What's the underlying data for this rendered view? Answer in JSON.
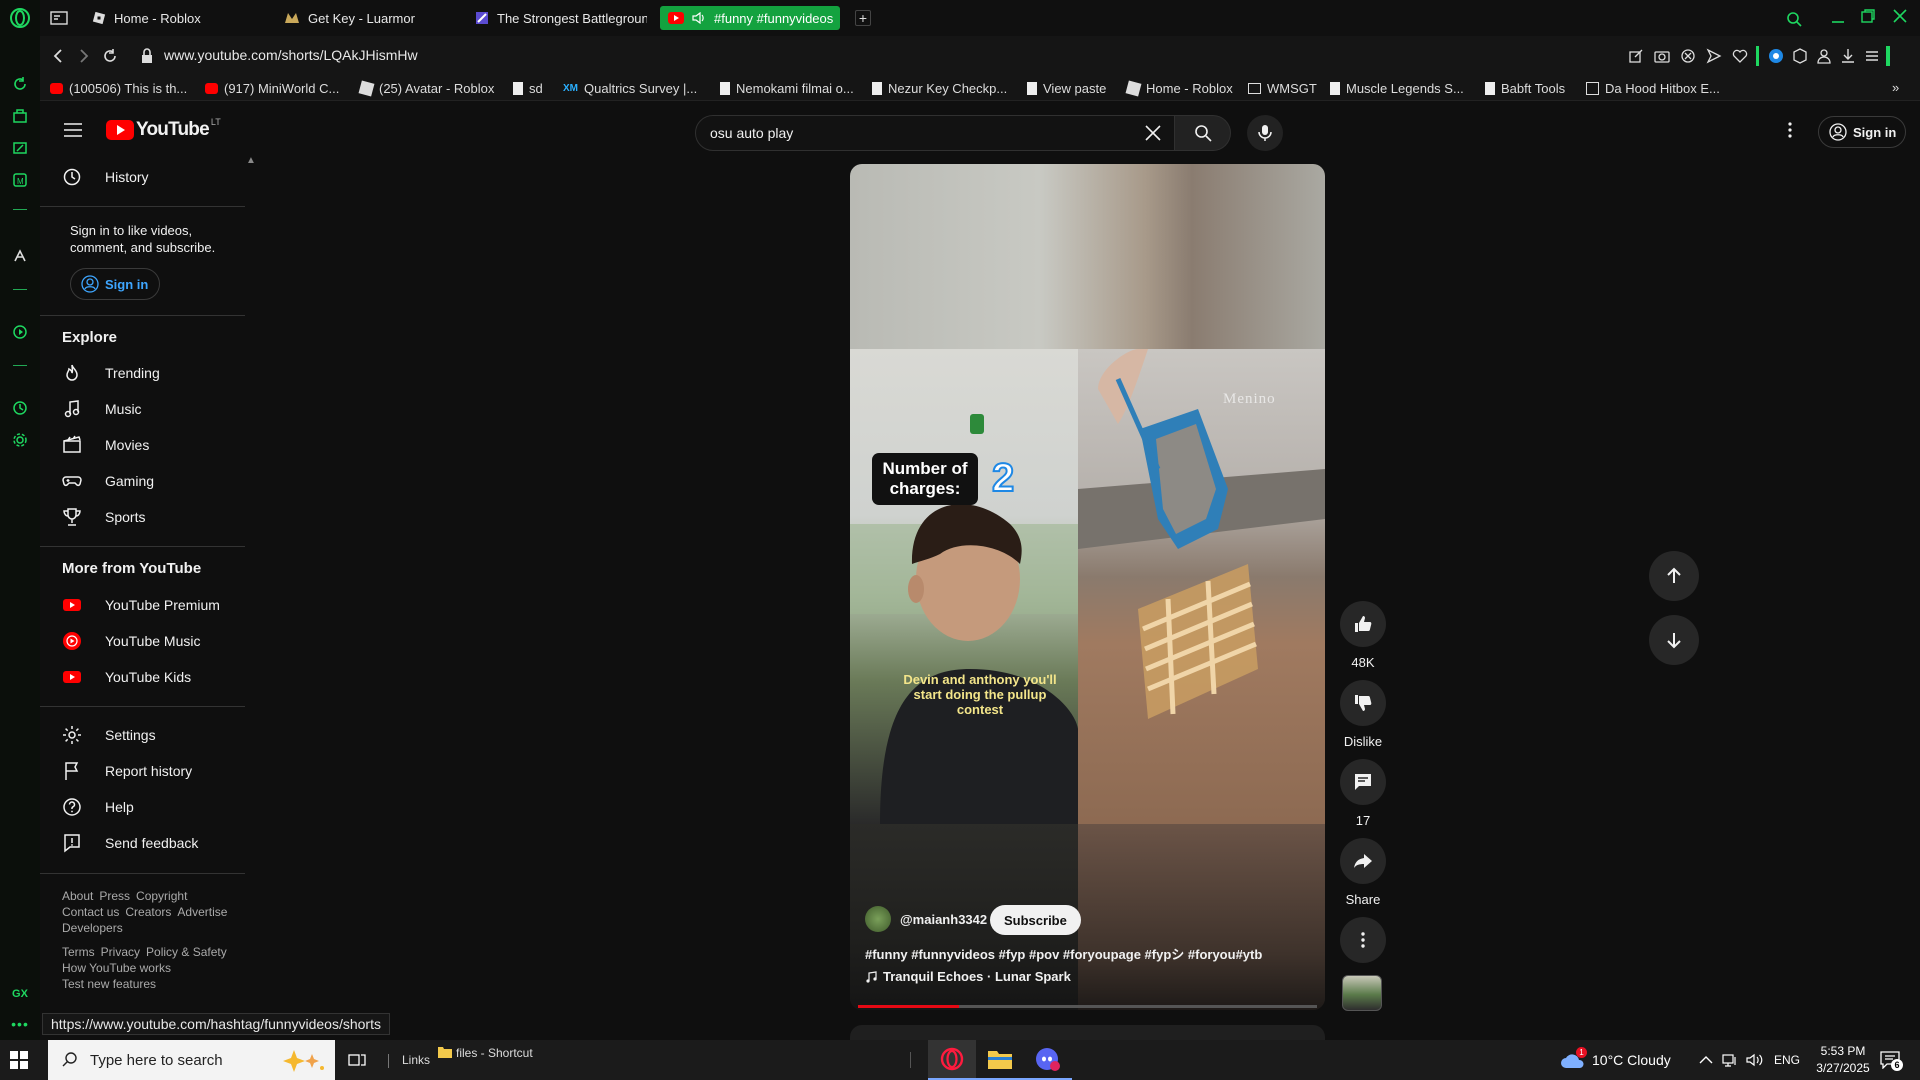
{
  "colors": {
    "opera_green": "#1ed760",
    "tab_active": "#13a23f",
    "yt_red": "#ff0000",
    "progress_red": "#e50914"
  },
  "browser": {
    "tabs": [
      {
        "label": "Home - Roblox",
        "icon": "roblox-icon",
        "active": false
      },
      {
        "label": "Get Key - Luarmor",
        "icon": "luarmor-icon",
        "active": false
      },
      {
        "label": "The Strongest Battlegroun",
        "icon": "battlegrounds-icon",
        "active": false
      },
      {
        "label": "#funny #funnyvideos",
        "icon": "youtube-icon",
        "active": true
      }
    ],
    "url": "www.youtube.com/shorts/LQAkJHismHw",
    "bookmarks": [
      {
        "label": "(100506) This is th...",
        "icon": "youtube-icon"
      },
      {
        "label": "(917) MiniWorld C...",
        "icon": "youtube-icon"
      },
      {
        "label": "(25) Avatar - Roblox",
        "icon": "roblox-icon"
      },
      {
        "label": "sd",
        "icon": "doc-icon"
      },
      {
        "label": "Qualtrics Survey |...",
        "icon": "xm-icon",
        "badge": "XM"
      },
      {
        "label": "Nemokami filmai o...",
        "icon": "doc-icon"
      },
      {
        "label": "Nezur Key Checkp...",
        "icon": "doc-icon"
      },
      {
        "label": "View paste",
        "icon": "doc-icon"
      },
      {
        "label": "Home - Roblox",
        "icon": "roblox-icon"
      },
      {
        "label": "WMSGT",
        "icon": "folder-icon"
      },
      {
        "label": "Muscle Legends S...",
        "icon": "doc-icon"
      },
      {
        "label": "Babft Tools",
        "icon": "doc-icon"
      },
      {
        "label": "Da Hood Hitbox E...",
        "icon": "grid-icon"
      }
    ],
    "status_url": "https://www.youtube.com/hashtag/funnyvideos/shorts"
  },
  "youtube": {
    "logo_text": "YouTube",
    "country_code": "LT",
    "search_value": "osu auto play",
    "sign_in_label": "Sign in",
    "sidebar": {
      "history": "History",
      "signin_prompt": "Sign in to like videos, comment, and subscribe.",
      "signin_button": "Sign in",
      "explore_heading": "Explore",
      "explore": [
        {
          "label": "Trending",
          "icon": "trending-icon"
        },
        {
          "label": "Music",
          "icon": "music-icon"
        },
        {
          "label": "Movies",
          "icon": "movies-icon"
        },
        {
          "label": "Gaming",
          "icon": "gaming-icon"
        },
        {
          "label": "Sports",
          "icon": "trophy-icon"
        }
      ],
      "more_heading": "More from YouTube",
      "more": [
        {
          "label": "YouTube Premium",
          "icon": "yt-premium-icon"
        },
        {
          "label": "YouTube Music",
          "icon": "yt-music-icon"
        },
        {
          "label": "YouTube Kids",
          "icon": "yt-kids-icon"
        }
      ],
      "settings": [
        {
          "label": "Settings",
          "icon": "gear-icon"
        },
        {
          "label": "Report history",
          "icon": "flag-icon"
        },
        {
          "label": "Help",
          "icon": "help-icon"
        },
        {
          "label": "Send feedback",
          "icon": "feedback-icon"
        }
      ],
      "footer1": [
        "About",
        "Press",
        "Copyright",
        "Contact us",
        "Creators",
        "Advertise",
        "Developers"
      ],
      "footer2": [
        "Terms",
        "Privacy",
        "Policy & Safety",
        "How YouTube works",
        "Test new features"
      ]
    },
    "short": {
      "overlay_label": "Number of charges:",
      "overlay_number": "2",
      "watermark": "Menino",
      "caption": "Devin and anthony you'll start doing the pullup contest",
      "channel": "@maianh3342",
      "subscribe": "Subscribe",
      "title": "#funny #funnyvideos #fyp #pov #foryoupage #fypシ #foryou#ytb",
      "music": "Tranquil Echoes · Lunar Spark",
      "progress": 0.22
    },
    "actions": {
      "likes": "48K",
      "dislike": "Dislike",
      "comments": "17",
      "share": "Share"
    }
  },
  "taskbar": {
    "search_placeholder": "Type here to search",
    "links": "Links",
    "shortcut": "files - Shortcut",
    "weather": "10°C  Cloudy",
    "weather_badge": "1",
    "lang": "ENG",
    "time": "5:53 PM",
    "date": "3/27/2025",
    "notif_count": "6"
  }
}
